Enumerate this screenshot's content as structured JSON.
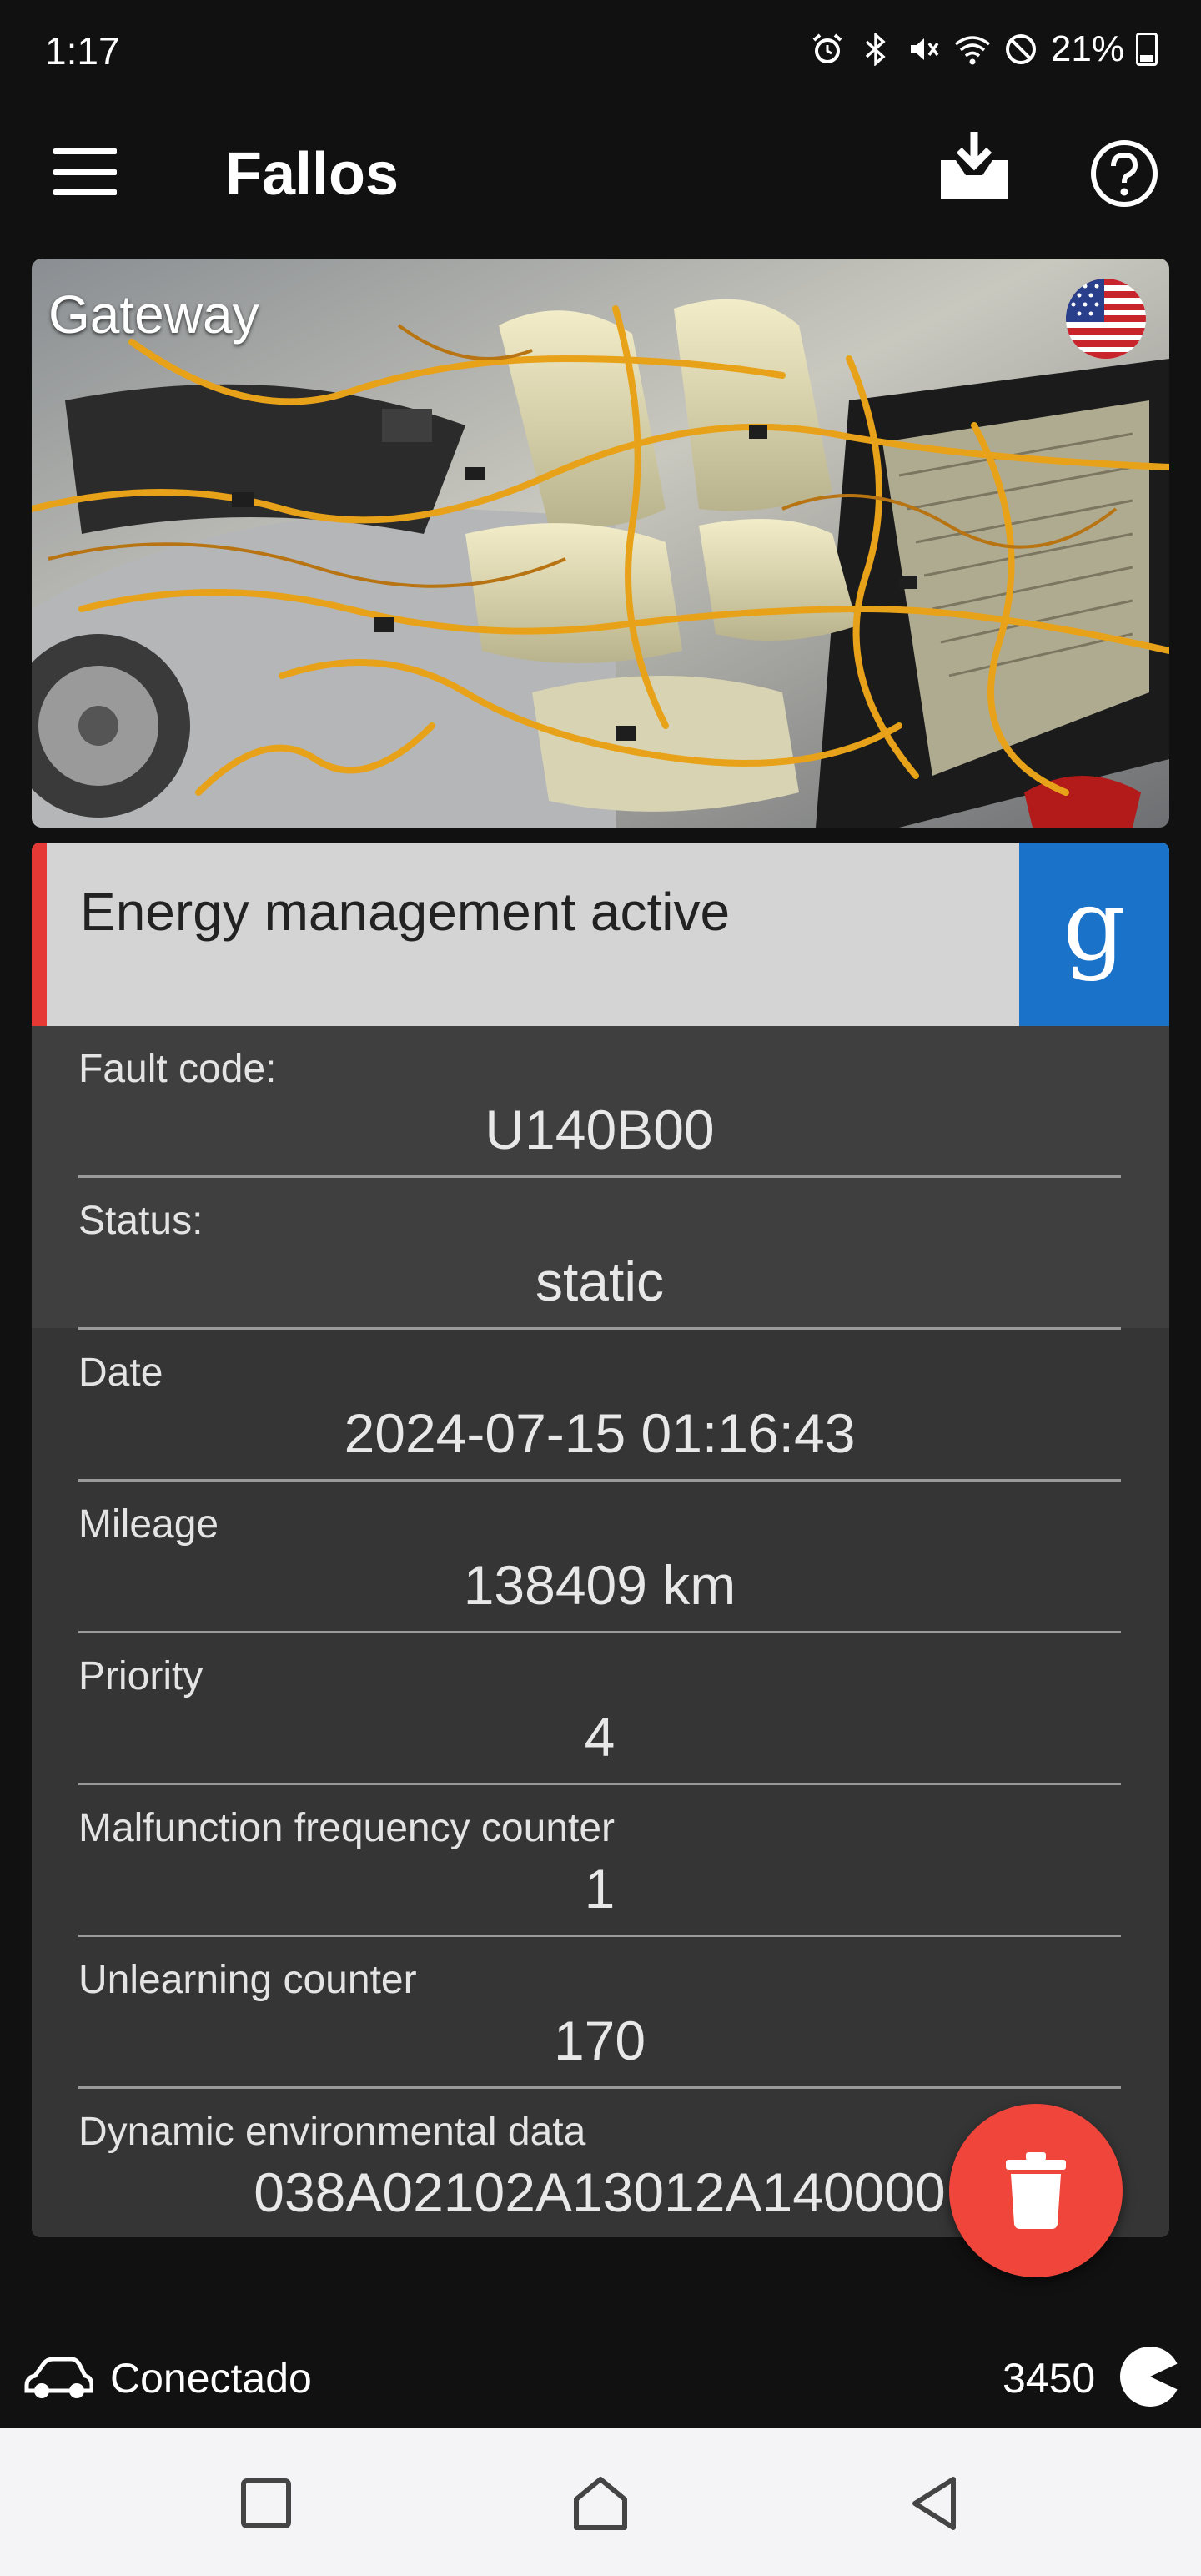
{
  "status_bar": {
    "time": "1:17",
    "battery_percent": "21%",
    "icons": [
      "alarm-icon",
      "bluetooth-icon",
      "vibrate-mute-icon",
      "wifi-icon",
      "do-not-disturb-icon",
      "battery-icon"
    ]
  },
  "app_bar": {
    "title": "Fallos",
    "icons": [
      "menu-icon",
      "download-icon",
      "help-icon"
    ]
  },
  "hero": {
    "title": "Gateway",
    "flag": "us-flag-icon"
  },
  "fault": {
    "title": "Energy management active",
    "google_button_label": "g",
    "accent_color": "#e53935",
    "google_color": "#1a73c9",
    "fields": [
      {
        "label": "Fault code:",
        "value": "U140B00"
      },
      {
        "label": "Status:",
        "value": "static"
      },
      {
        "label": "Date",
        "value": "2024-07-15 01:16:43"
      },
      {
        "label": "Mileage",
        "value": "138409 km"
      },
      {
        "label": "Priority",
        "value": "4"
      },
      {
        "label": "Malfunction frequency counter",
        "value": "1"
      },
      {
        "label": "Unlearning counter",
        "value": "170"
      },
      {
        "label": "Dynamic environmental data",
        "value": "038A02102A13012A140000"
      }
    ]
  },
  "delete_fab": {
    "icon": "trash-icon",
    "color": "#f0453a"
  },
  "connection": {
    "label": "Conectado",
    "count": "3450",
    "icons": [
      "car-icon",
      "pacman-icon"
    ]
  },
  "system_nav": {
    "buttons": [
      "recents-button",
      "home-button",
      "back-button"
    ]
  }
}
